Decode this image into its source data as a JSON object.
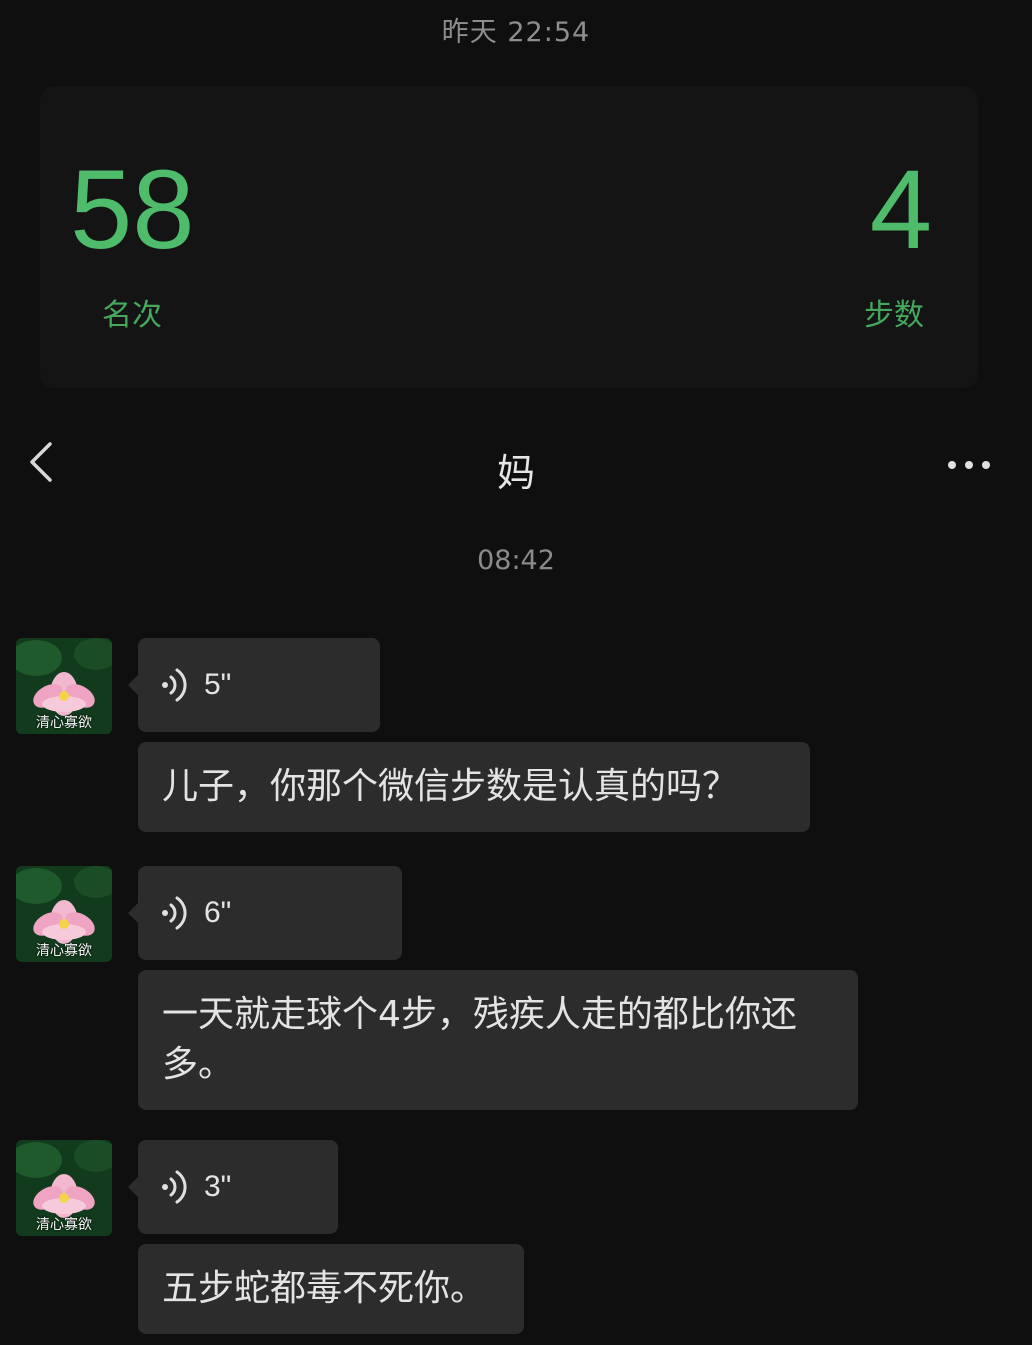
{
  "top_timestamp": "昨天 22:54",
  "rank_card": {
    "rank_value": "58",
    "rank_label": "名次",
    "steps_value": "4",
    "steps_label": "步数"
  },
  "nav": {
    "back_icon": "chevron-left-icon",
    "title": "妈",
    "more_icon": "more-dots-icon"
  },
  "message_time": "08:42",
  "avatar_caption": "清心寡欲",
  "messages": [
    {
      "voice_duration": "5\"",
      "text": "儿子，你那个微信步数是认真的吗？"
    },
    {
      "voice_duration": "6\"",
      "text": "一天就走球个4步，残疾人走的都比你还多。"
    },
    {
      "voice_duration": "3\"",
      "text": "五步蛇都毒不死你。"
    }
  ],
  "colors": {
    "background": "#0f0f0f",
    "accent_green": "#4ebc6a",
    "bubble": "#2c2c2c"
  }
}
